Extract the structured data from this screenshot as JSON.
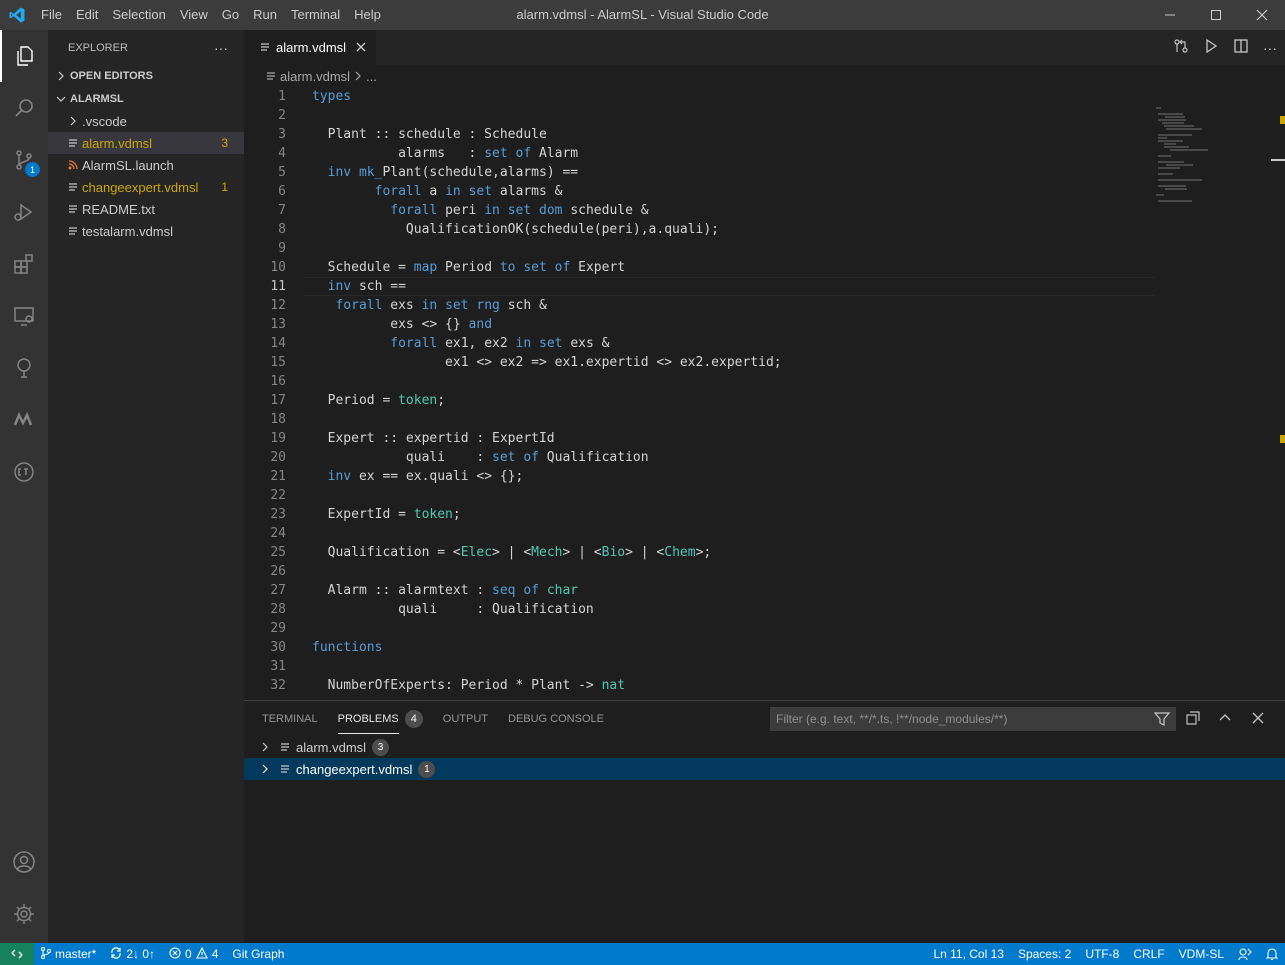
{
  "titlebar": {
    "menu": [
      "File",
      "Edit",
      "Selection",
      "View",
      "Go",
      "Run",
      "Terminal",
      "Help"
    ],
    "title": "alarm.vdmsl - AlarmSL - Visual Studio Code"
  },
  "activity": {
    "source_control_badge": "1"
  },
  "sidebar": {
    "header": "EXPLORER",
    "more": "···",
    "open_editors": "OPEN EDITORS",
    "project": "ALARMSL",
    "items": [
      {
        "name": ".vscode",
        "count": ""
      },
      {
        "name": "alarm.vdmsl",
        "count": "3"
      },
      {
        "name": "AlarmSL.launch",
        "count": ""
      },
      {
        "name": "changeexpert.vdmsl",
        "count": "1"
      },
      {
        "name": "README.txt",
        "count": ""
      },
      {
        "name": "testalarm.vdmsl",
        "count": ""
      }
    ]
  },
  "editor": {
    "tab": "alarm.vdmsl",
    "breadcrumb_file": "alarm.vdmsl",
    "breadcrumb_more": "...",
    "lines": [
      "types",
      "",
      "  Plant :: schedule : Schedule",
      "           alarms   : set of Alarm",
      "  inv mk_Plant(schedule,alarms) ==",
      "        forall a in set alarms &",
      "          forall peri in set dom schedule &",
      "            QualificationOK(schedule(peri),a.quali);",
      "",
      "  Schedule = map Period to set of Expert",
      "  inv sch ==",
      "   forall exs in set rng sch &",
      "          exs <> {} and",
      "          forall ex1, ex2 in set exs &",
      "                 ex1 <> ex2 => ex1.expertid <> ex2.expertid;",
      "",
      "  Period = token;",
      "",
      "  Expert :: expertid : ExpertId",
      "            quali    : set of Qualification",
      "  inv ex == ex.quali <> {};",
      "",
      "  ExpertId = token;",
      "",
      "  Qualification = <Elec> | <Mech> | <Bio> | <Chem>;",
      "",
      "  Alarm :: alarmtext : seq of char",
      "           quali     : Qualification",
      "",
      "functions",
      "",
      "  NumberOfExperts: Period * Plant -> nat"
    ],
    "current_line": 11
  },
  "panel": {
    "tabs": [
      "TERMINAL",
      "PROBLEMS",
      "OUTPUT",
      "DEBUG CONSOLE"
    ],
    "problems_count": "4",
    "filter_placeholder": "Filter (e.g. text, **/*.ts, !**/node_modules/**)",
    "rows": [
      {
        "file": "alarm.vdmsl",
        "count": "3"
      },
      {
        "file": "changeexpert.vdmsl",
        "count": "1"
      }
    ]
  },
  "statusbar": {
    "branch": "master*",
    "sync": "2↓ 0↑",
    "errors": "0",
    "warnings": "4",
    "git_graph": "Git Graph",
    "position": "Ln 11, Col 13",
    "spaces": "Spaces: 2",
    "encoding": "UTF-8",
    "eol": "CRLF",
    "language": "VDM-SL"
  },
  "colors": {
    "accent": "#007acc",
    "warning": "#cca700",
    "remote": "#16825d"
  }
}
